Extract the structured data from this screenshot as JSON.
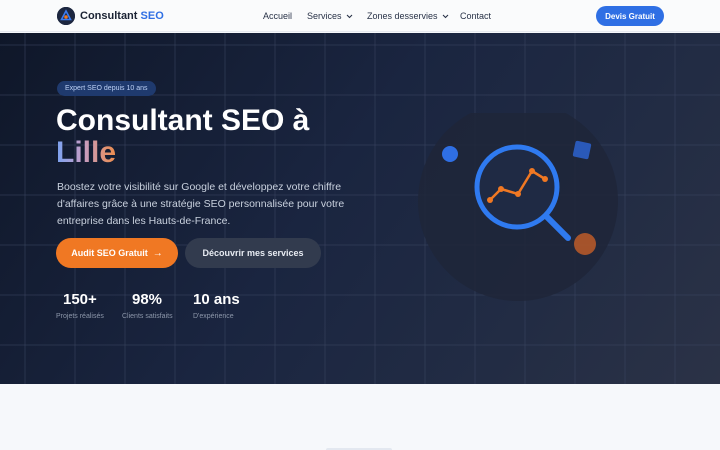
{
  "nav": {
    "logo_main": "Consultant",
    "logo_accent": "SEO",
    "items": [
      {
        "label": "Accueil",
        "has_dropdown": false
      },
      {
        "label": "Services",
        "has_dropdown": true
      },
      {
        "label": "Zones desservies",
        "has_dropdown": true
      },
      {
        "label": "Contact",
        "has_dropdown": false
      }
    ],
    "cta": "Devis Gratuit"
  },
  "hero": {
    "badge": "Expert SEO depuis 10 ans",
    "title_line1": "Consultant SEO à",
    "title_line2": "Lille",
    "description": "Boostez votre visibilité sur Google et développez votre chiffre d'affaires grâce à une stratégie SEO personnalisée pour votre entreprise dans les Hauts-de-France.",
    "primary_button": "Audit SEO Gratuit",
    "primary_button_icon": "arrow-right-icon",
    "secondary_button": "Découvrir mes services",
    "stats": [
      {
        "value": "150+",
        "label": "Projets réalisés"
      },
      {
        "value": "98%",
        "label": "Clients satisfaits"
      },
      {
        "value": "10 ans",
        "label": "D'expérience"
      }
    ],
    "illustration_icon": "magnifier-chart-icon"
  },
  "colors": {
    "brand_blue": "#2f6fe4",
    "accent_orange": "#f07823",
    "hero_bg": "#1a2540"
  }
}
